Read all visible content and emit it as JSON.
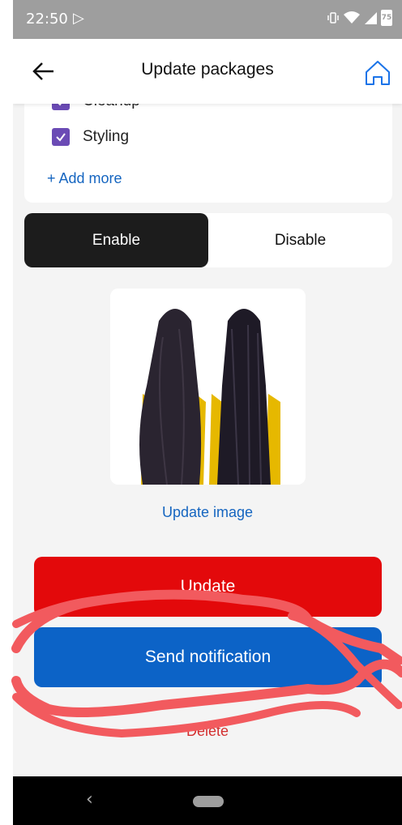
{
  "status_bar": {
    "time": "22:50",
    "battery": "75"
  },
  "app_bar": {
    "title": "Update packages",
    "back_icon": "arrow-left-icon",
    "home_icon": "home-icon"
  },
  "checklist": {
    "items": [
      {
        "label": "Cleanup",
        "checked": true
      },
      {
        "label": "Styling",
        "checked": true
      }
    ],
    "add_more_label": "+ Add more"
  },
  "toggle": {
    "options": [
      "Enable",
      "Disable"
    ],
    "selected": "Enable"
  },
  "image": {
    "alt": "hair-comparison-image",
    "update_label": "Update image"
  },
  "actions": {
    "update_label": "Update",
    "notify_label": "Send notification",
    "delete_label": "Delete"
  },
  "colors": {
    "update": "#e3090b",
    "notify": "#0c63c7",
    "delete": "#d32f2f",
    "link": "#1565c0",
    "checkbox": "#6b4bb5",
    "toggle_active": "#1c1c1c",
    "annotation": "#f25a5e"
  }
}
